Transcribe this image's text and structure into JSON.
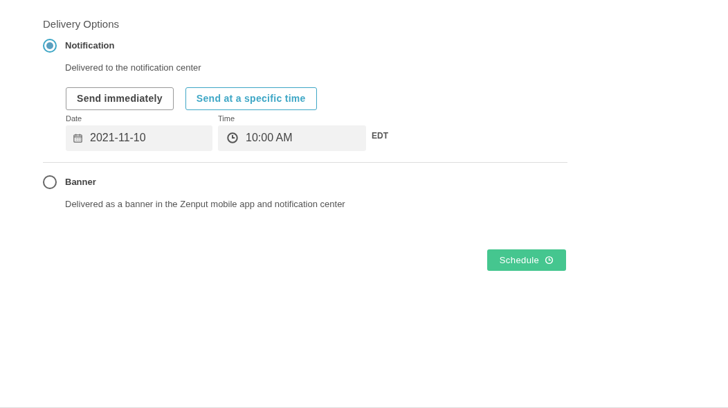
{
  "section_title": "Delivery Options",
  "options": [
    {
      "label": "Notification",
      "description": "Delivered to the notification center",
      "selected": true,
      "schedule": {
        "send_modes": [
          {
            "label": "Send immediately",
            "selected": false
          },
          {
            "label": "Send at a specific time",
            "selected": true
          }
        ],
        "date": {
          "label": "Date",
          "value": "2021-11-10"
        },
        "time": {
          "label": "Time",
          "value": "10:00 AM"
        },
        "timezone": "EDT"
      }
    },
    {
      "label": "Banner",
      "description": "Delivered as a banner in the Zenput mobile app and notification center",
      "selected": false
    }
  ],
  "submit": {
    "label": "Schedule"
  }
}
